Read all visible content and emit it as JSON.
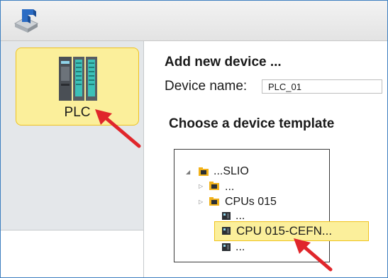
{
  "left_panel": {
    "plc_tile": {
      "label": "PLC"
    }
  },
  "main": {
    "add_heading": "Add new device ...",
    "device_name_label": "Device name:",
    "device_name_value": "PLC_01",
    "template_heading": "Choose a device template"
  },
  "tree": {
    "root": {
      "label": "...SLIO",
      "expanded": true
    },
    "child_ellipsis": {
      "label": "...",
      "expanded": false
    },
    "cpus": {
      "label": "CPUs 015",
      "expanded": false
    },
    "cpu_prev": {
      "label": "..."
    },
    "cpu_selected": {
      "label": "CPU 015-CEFN..."
    },
    "cpu_next": {
      "label": "..."
    }
  },
  "colors": {
    "highlight_fill": "#fbef9b",
    "highlight_border": "#f0c31e",
    "pointer_arrow": "#e0262b",
    "frame_border": "#3d7fc0"
  },
  "icons": [
    "app-logo-icon",
    "plc-module-icon",
    "expanded-triangle-icon",
    "collapsed-triangle-icon",
    "folder-icon",
    "cpu-chip-icon",
    "red-pointer-arrow"
  ]
}
